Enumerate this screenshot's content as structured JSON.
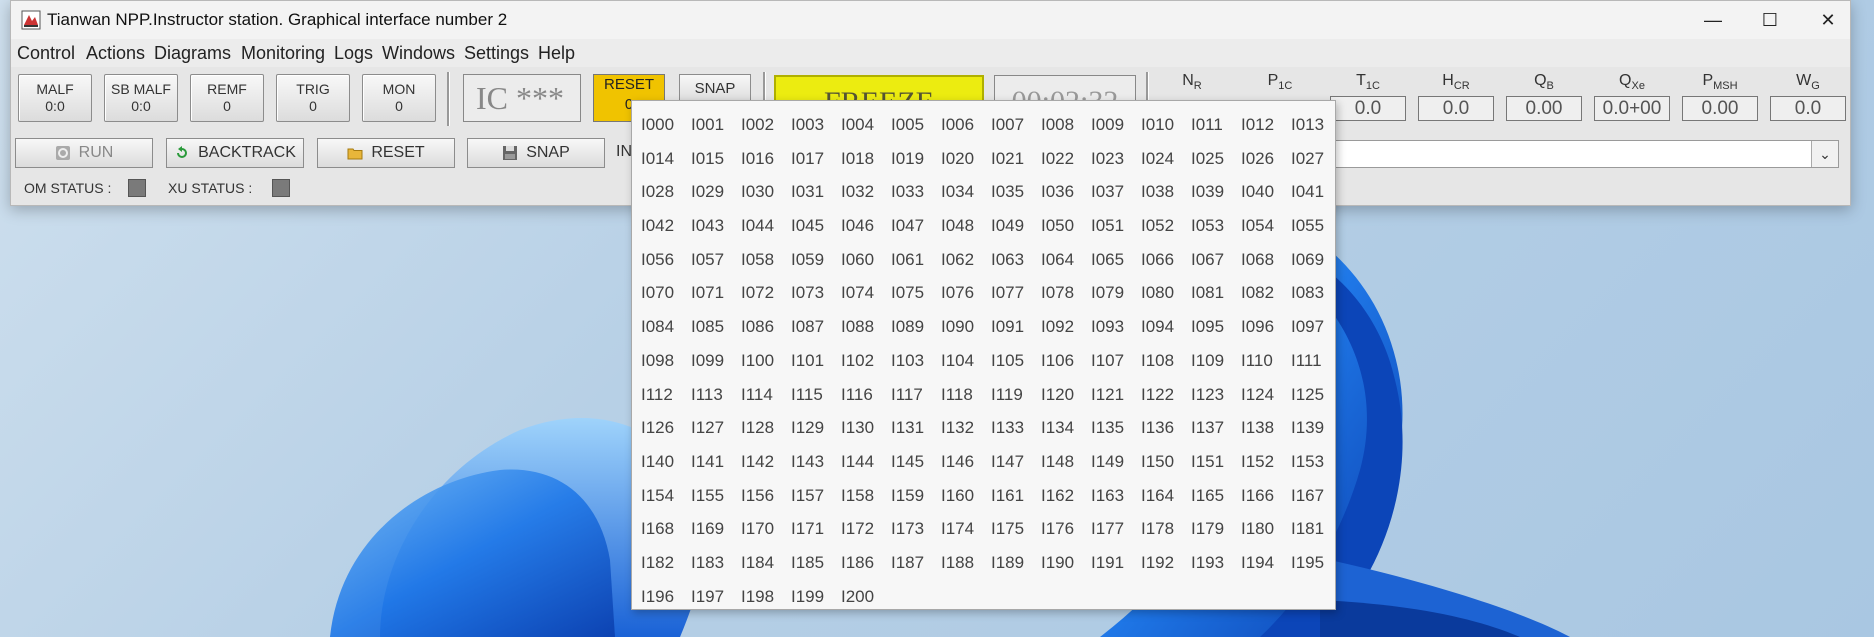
{
  "window": {
    "title": "Tianwan NPP.Instructor station. Graphical interface number 2",
    "minimize": "—",
    "maximize": "☐",
    "close": "✕",
    "icon": "app-icon"
  },
  "menu": [
    "Control",
    "Actions",
    "Diagrams",
    "Monitoring",
    "Logs",
    "Windows",
    "Settings",
    "Help"
  ],
  "counters": [
    {
      "label": "MALF",
      "value": "0:0"
    },
    {
      "label": "SB MALF",
      "value": "0:0"
    },
    {
      "label": "REMF",
      "value": "0"
    },
    {
      "label": "TRIG",
      "value": "0"
    },
    {
      "label": "MON",
      "value": "0"
    }
  ],
  "ic_display": "IC ***",
  "reset_top": {
    "label": "RESET",
    "value": "0"
  },
  "snap_top": "SNAP",
  "freeze": "FREEZE",
  "timer": "00:02:32",
  "params": {
    "labels": [
      {
        "base": "N",
        "sub": "R"
      },
      {
        "base": "P",
        "sub": "1C"
      },
      {
        "base": "T",
        "sub": "1C"
      },
      {
        "base": "H",
        "sub": "CR"
      },
      {
        "base": "Q",
        "sub": "B"
      },
      {
        "base": "Q",
        "sub": "Xe"
      },
      {
        "base": "P",
        "sub": "MSH"
      },
      {
        "base": "W",
        "sub": "G"
      }
    ],
    "values": [
      "0.0",
      "0.0",
      "0.00",
      "0.0+00",
      "0.00",
      "0.0"
    ]
  },
  "toolbar": {
    "run": "RUN",
    "backtrack": "BACKTRACK",
    "reset": "RESET",
    "snap": "SNAP",
    "in_label": "IN",
    "combo_value": ""
  },
  "status": {
    "om": "OM STATUS :",
    "xu": "XU STATUS :"
  },
  "ic_list": [
    "I000",
    "I001",
    "I002",
    "I003",
    "I004",
    "I005",
    "I006",
    "I007",
    "I008",
    "I009",
    "I010",
    "I011",
    "I012",
    "I013",
    "I014",
    "I015",
    "I016",
    "I017",
    "I018",
    "I019",
    "I020",
    "I021",
    "I022",
    "I023",
    "I024",
    "I025",
    "I026",
    "I027",
    "I028",
    "I029",
    "I030",
    "I031",
    "I032",
    "I033",
    "I034",
    "I035",
    "I036",
    "I037",
    "I038",
    "I039",
    "I040",
    "I041",
    "I042",
    "I043",
    "I044",
    "I045",
    "I046",
    "I047",
    "I048",
    "I049",
    "I050",
    "I051",
    "I052",
    "I053",
    "I054",
    "I055",
    "I056",
    "I057",
    "I058",
    "I059",
    "I060",
    "I061",
    "I062",
    "I063",
    "I064",
    "I065",
    "I066",
    "I067",
    "I068",
    "I069",
    "I070",
    "I071",
    "I072",
    "I073",
    "I074",
    "I075",
    "I076",
    "I077",
    "I078",
    "I079",
    "I080",
    "I081",
    "I082",
    "I083",
    "I084",
    "I085",
    "I086",
    "I087",
    "I088",
    "I089",
    "I090",
    "I091",
    "I092",
    "I093",
    "I094",
    "I095",
    "I096",
    "I097",
    "I098",
    "I099",
    "I100",
    "I101",
    "I102",
    "I103",
    "I104",
    "I105",
    "I106",
    "I107",
    "I108",
    "I109",
    "I110",
    "I111",
    "I112",
    "I113",
    "I114",
    "I115",
    "I116",
    "I117",
    "I118",
    "I119",
    "I120",
    "I121",
    "I122",
    "I123",
    "I124",
    "I125",
    "I126",
    "I127",
    "I128",
    "I129",
    "I130",
    "I131",
    "I132",
    "I133",
    "I134",
    "I135",
    "I136",
    "I137",
    "I138",
    "I139",
    "I140",
    "I141",
    "I142",
    "I143",
    "I144",
    "I145",
    "I146",
    "I147",
    "I148",
    "I149",
    "I150",
    "I151",
    "I152",
    "I153",
    "I154",
    "I155",
    "I156",
    "I157",
    "I158",
    "I159",
    "I160",
    "I161",
    "I162",
    "I163",
    "I164",
    "I165",
    "I166",
    "I167",
    "I168",
    "I169",
    "I170",
    "I171",
    "I172",
    "I173",
    "I174",
    "I175",
    "I176",
    "I177",
    "I178",
    "I179",
    "I180",
    "I181",
    "I182",
    "I183",
    "I184",
    "I185",
    "I186",
    "I187",
    "I188",
    "I189",
    "I190",
    "I191",
    "I192",
    "I193",
    "I194",
    "I195",
    "I196",
    "I197",
    "I198",
    "I199",
    "I200"
  ],
  "colors": {
    "freeze_bg": "#ecec10",
    "reset_bg": "#f0c300",
    "wallpaper_blue": "#1a6fe0"
  }
}
